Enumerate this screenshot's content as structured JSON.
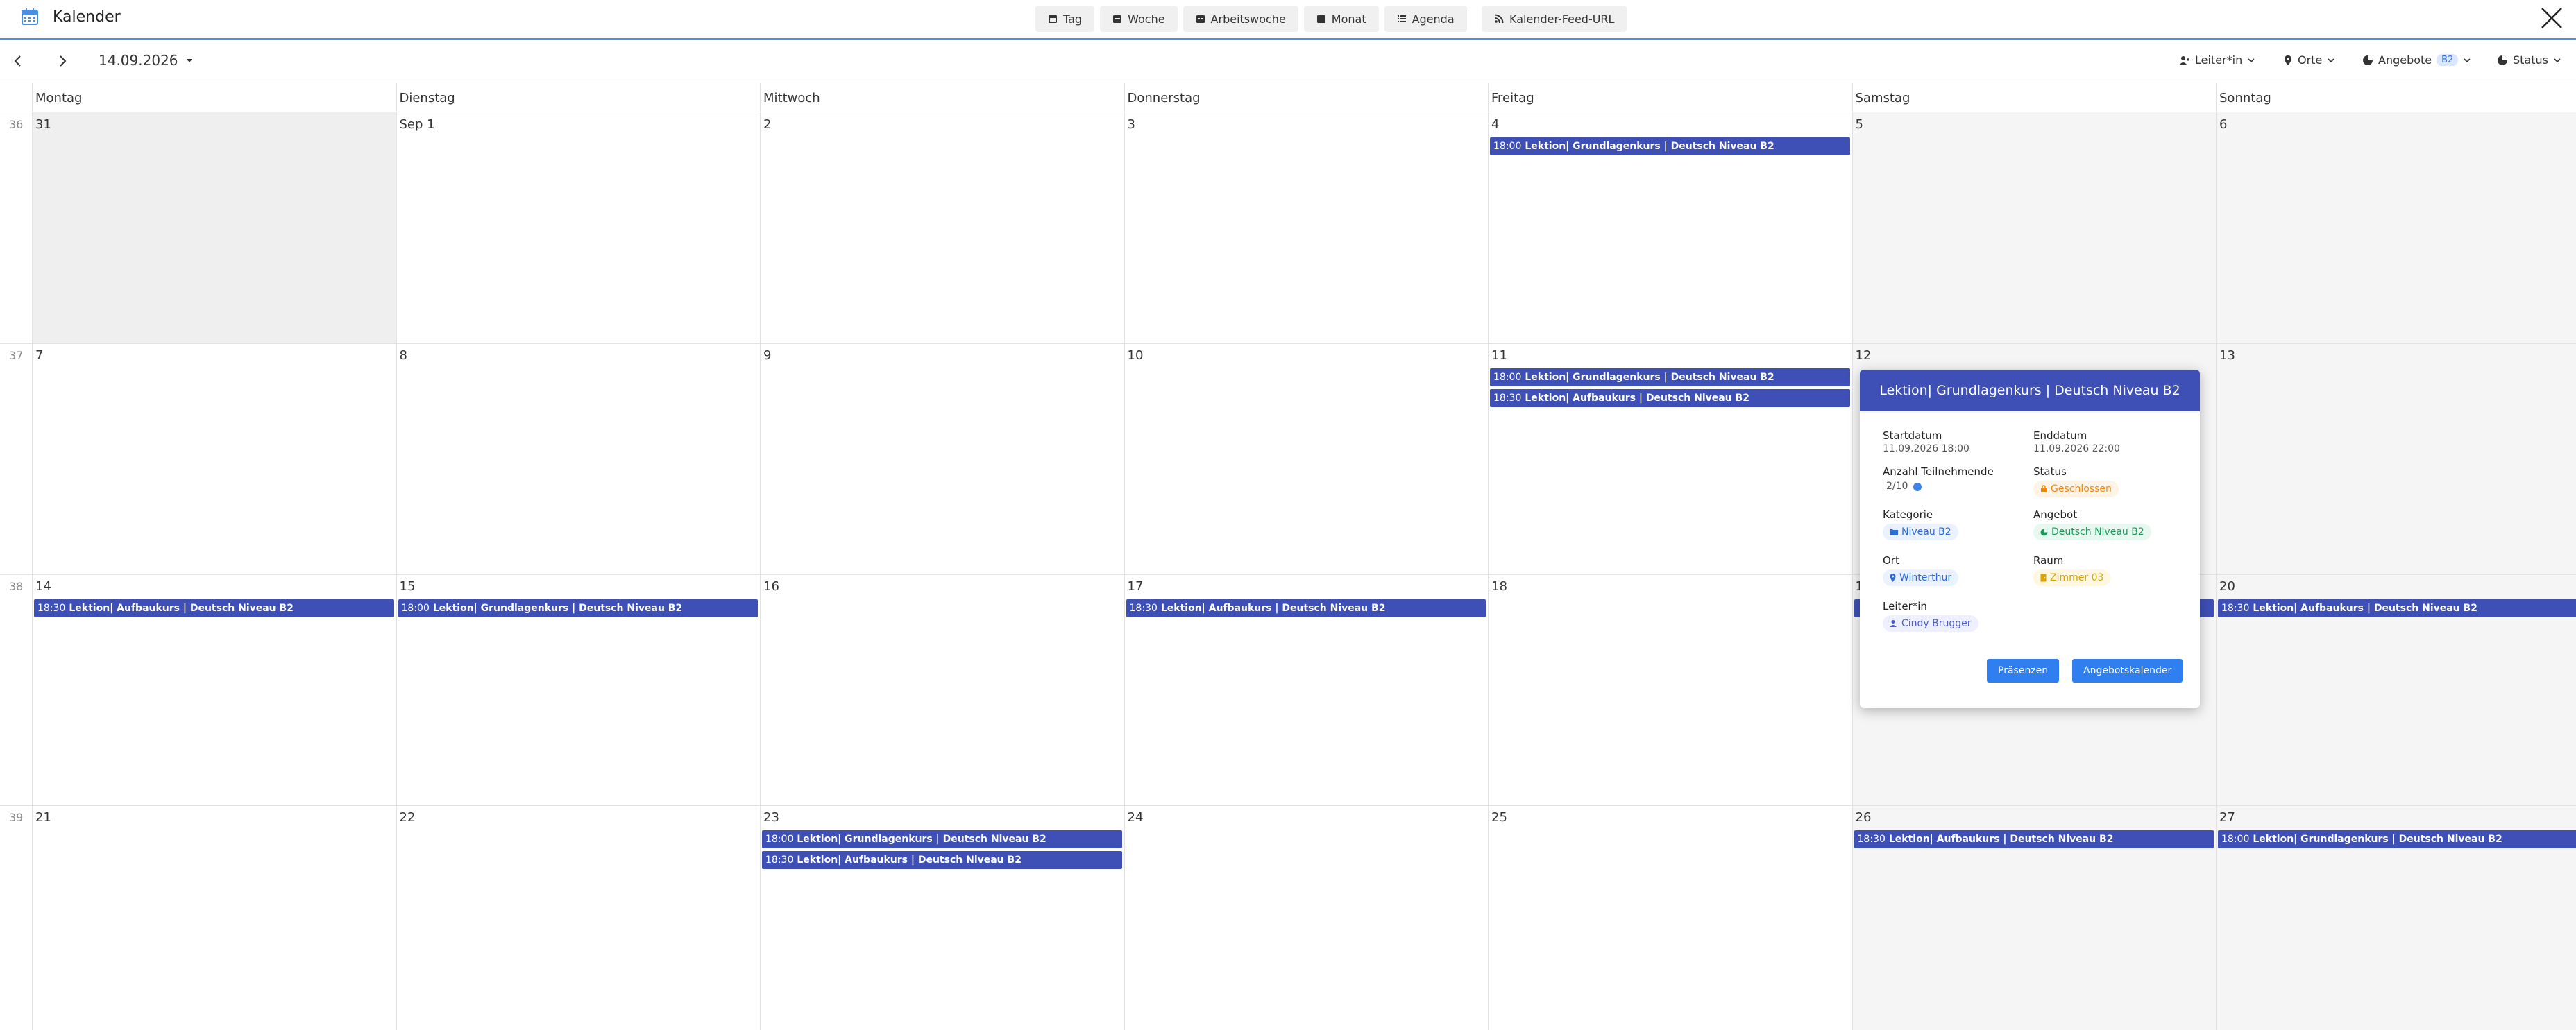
{
  "app": {
    "title": "Kalender",
    "icon": "calendar-icon"
  },
  "views": [
    {
      "label": "Tag",
      "icon": "day-icon"
    },
    {
      "label": "Woche",
      "icon": "week-icon"
    },
    {
      "label": "Arbeitswoche",
      "icon": "workweek-icon"
    },
    {
      "label": "Monat",
      "icon": "month-icon"
    },
    {
      "label": "Agenda",
      "icon": "list-icon"
    }
  ],
  "feed": {
    "label": "Kalender-Feed-URL",
    "icon": "rss-icon"
  },
  "toolbar": {
    "date": "14.09.2026",
    "filters": {
      "leader": "Leiter*in",
      "places": "Orte",
      "offers": "Angebote",
      "offers_badge": "B2",
      "status": "Status"
    }
  },
  "weekdays": [
    "Montag",
    "Dienstag",
    "Mittwoch",
    "Donnerstag",
    "Freitag",
    "Samstag",
    "Sonntag"
  ],
  "weeks": [
    {
      "num": "36",
      "days": [
        "31",
        "Sep 1",
        "2",
        "3",
        "4",
        "5",
        "6"
      ]
    },
    {
      "num": "37",
      "days": [
        "7",
        "8",
        "9",
        "10",
        "11",
        "12",
        "13"
      ]
    },
    {
      "num": "38",
      "days": [
        "14",
        "15",
        "16",
        "17",
        "18",
        "19",
        "20"
      ]
    },
    {
      "num": "39",
      "days": [
        "21",
        "22",
        "23",
        "24",
        "25",
        "26",
        "27"
      ]
    }
  ],
  "events": [
    {
      "week": 0,
      "day": 4,
      "slot": 0,
      "time": "18:00",
      "title": "Lektion| Grundlagenkurs | Deutsch Niveau B2"
    },
    {
      "week": 1,
      "day": 4,
      "slot": 0,
      "time": "18:00",
      "title": "Lektion| Grundlagenkurs | Deutsch Niveau B2"
    },
    {
      "week": 1,
      "day": 4,
      "slot": 1,
      "time": "18:30",
      "title": "Lektion| Aufbaukurs | Deutsch Niveau B2"
    },
    {
      "week": 2,
      "day": 0,
      "slot": 0,
      "time": "18:30",
      "title": "Lektion| Aufbaukurs | Deutsch Niveau B2"
    },
    {
      "week": 2,
      "day": 1,
      "slot": 0,
      "time": "18:00",
      "title": "Lektion| Grundlagenkurs | Deutsch Niveau B2"
    },
    {
      "week": 2,
      "day": 3,
      "slot": 0,
      "time": "18:30",
      "title": "Lektion| Aufbaukurs | Deutsch Niveau B2"
    },
    {
      "week": 2,
      "day": 5,
      "slot": 0,
      "time": "",
      "title": ""
    },
    {
      "week": 2,
      "day": 6,
      "slot": 0,
      "time": "18:30",
      "title": "Lektion| Aufbaukurs | Deutsch Niveau B2"
    },
    {
      "week": 3,
      "day": 2,
      "slot": 0,
      "time": "18:00",
      "title": "Lektion| Grundlagenkurs | Deutsch Niveau B2"
    },
    {
      "week": 3,
      "day": 2,
      "slot": 1,
      "time": "18:30",
      "title": "Lektion| Aufbaukurs | Deutsch Niveau B2"
    },
    {
      "week": 3,
      "day": 5,
      "slot": 0,
      "time": "18:30",
      "title": "Lektion| Aufbaukurs | Deutsch Niveau B2"
    },
    {
      "week": 3,
      "day": 6,
      "slot": 0,
      "time": "18:00",
      "title": "Lektion| Grundlagenkurs | Deutsch Niveau B2"
    }
  ],
  "popover": {
    "title": "Lektion| Grundlagenkurs | Deutsch Niveau B2",
    "start_label": "Startdatum",
    "start_value": "11.09.2026 18:00",
    "end_label": "Enddatum",
    "end_value": "11.09.2026 22:00",
    "participants_label": "Anzahl Teilnehmende",
    "participants_value": "2/10",
    "status_label": "Status",
    "status_value": "Geschlossen",
    "category_label": "Kategorie",
    "category_value": "Niveau B2",
    "offer_label": "Angebot",
    "offer_value": "Deutsch Niveau B2",
    "place_label": "Ort",
    "place_value": "Winterthur",
    "room_label": "Raum",
    "room_value": "Zimmer 03",
    "leader_label": "Leiter*in",
    "leader_value": "Cindy Brugger",
    "btn_presence": "Präsenzen",
    "btn_calendar": "Angebotskalender"
  },
  "colors": {
    "accent": "#4a90e2",
    "event": "#3e4fb5",
    "button": "#2f7ff0",
    "weekend_bg": "#f5f5f5"
  }
}
